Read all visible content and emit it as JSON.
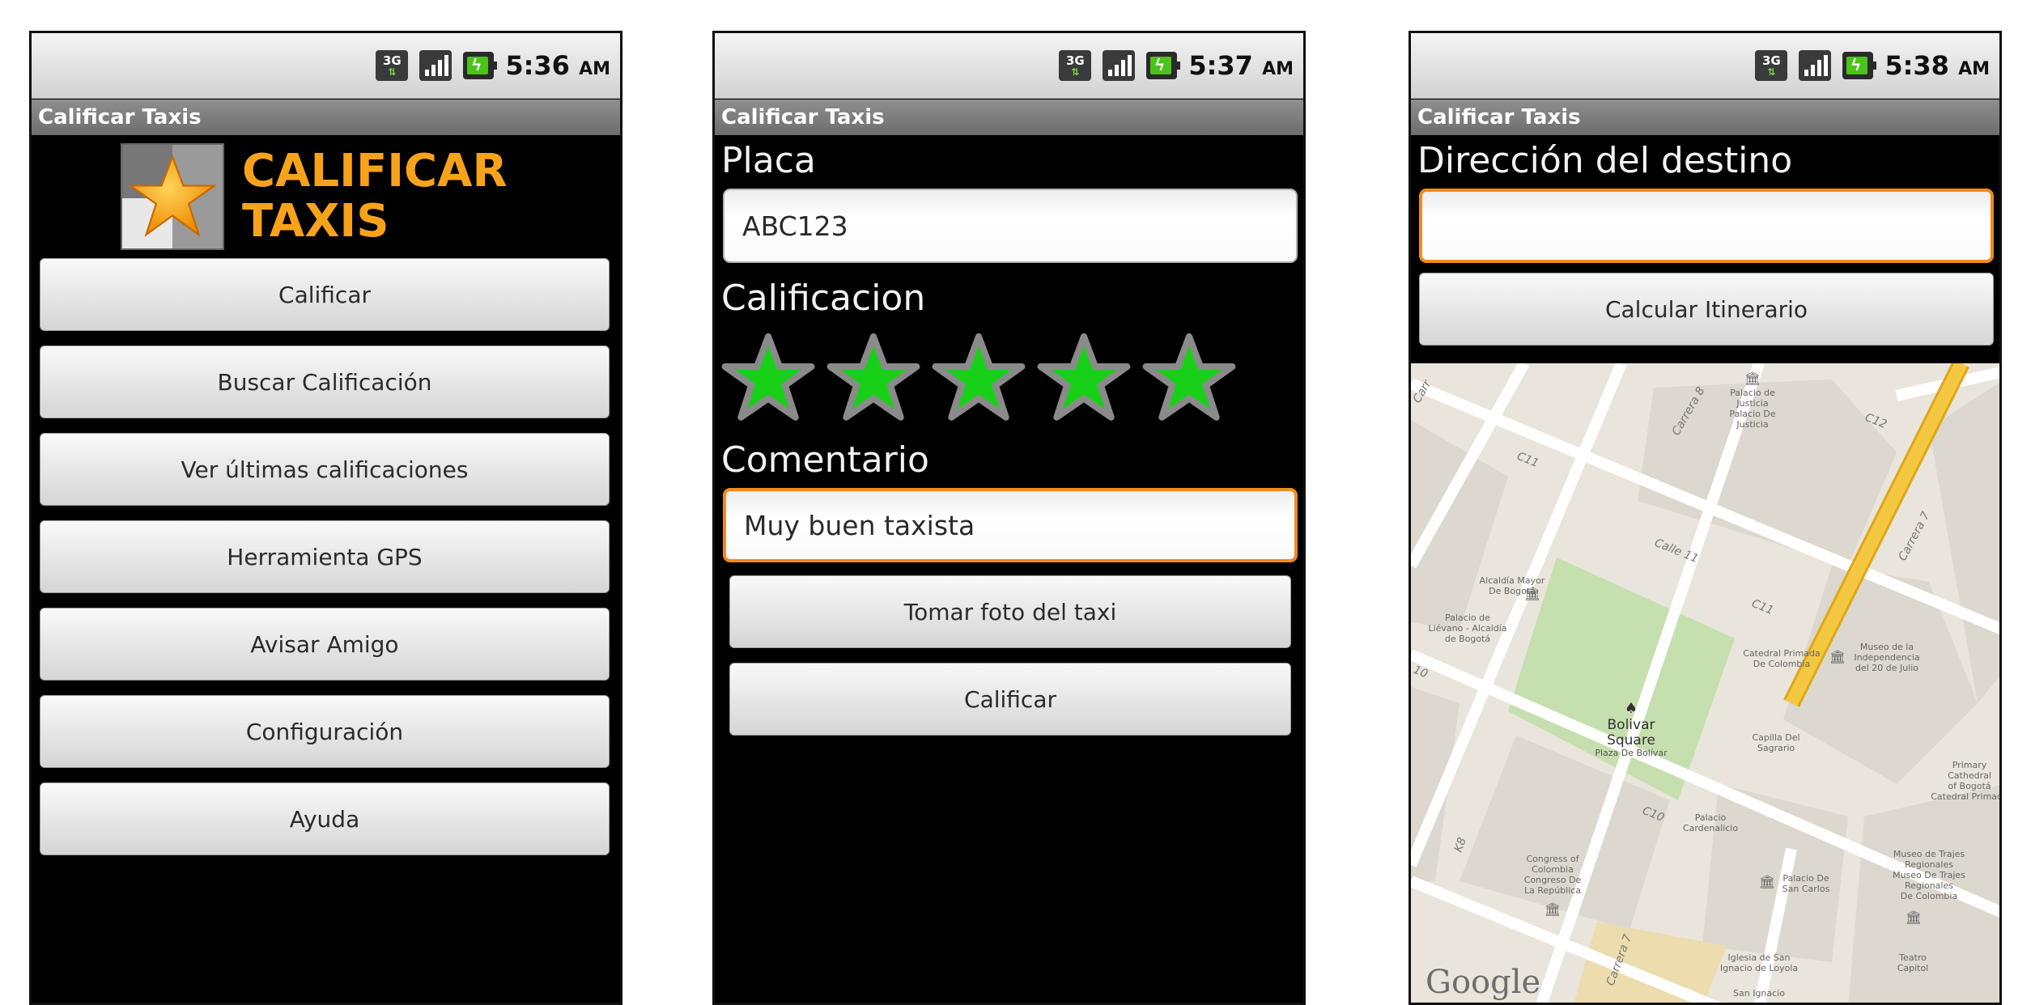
{
  "screens": [
    {
      "status": {
        "time": "5:36",
        "ampm": "AM",
        "network": "3G"
      },
      "title": "Calificar Taxis",
      "logo": {
        "line1": "CALIFICAR",
        "line2": "TAXIS"
      },
      "menu": [
        "Calificar",
        "Buscar Calificación",
        "Ver últimas calificaciones",
        "Herramienta GPS",
        "Avisar Amigo",
        "Configuración",
        "Ayuda"
      ]
    },
    {
      "status": {
        "time": "5:37",
        "ampm": "AM",
        "network": "3G"
      },
      "title": "Calificar Taxis",
      "placa_label": "Placa",
      "placa_value": "ABC123",
      "calificacion_label": "Calificacion",
      "rating": 5,
      "comentario_label": "Comentario",
      "comentario_value": "Muy buen taxista",
      "photo_button": "Tomar foto del taxi",
      "submit_button": "Calificar"
    },
    {
      "status": {
        "time": "5:38",
        "ampm": "AM",
        "network": "3G"
      },
      "title": "Calificar Taxis",
      "destino_label": "Dirección del destino",
      "destino_value": "",
      "calc_button": "Calcular Itinerario",
      "map": {
        "attribution": "Google",
        "labels": {
          "palacio_justicia": "Palacio de",
          "palacio_justicia2": "Justicia",
          "palacio_justicia3": "Palacio De",
          "palacio_justicia4": "Justicia",
          "carrera8": "Carrera 8",
          "c12": "C12",
          "c11": "C11",
          "carrera7": "Carrera 7",
          "calle11": "Calle 11",
          "c11b": "C11",
          "alcaldia": "Alcaldía Mayor",
          "alcaldia2": "De Bogotá",
          "lievano": "Palacio de",
          "lievano2": "Liévano - Alcaldía",
          "lievano3": "de Bogotá",
          "catedral": "Catedral Primada",
          "catedral2": "De Colombia",
          "museo_ind": "Museo de la",
          "museo_ind2": "Independencia",
          "museo_ind3": "del 20 de Julio",
          "c10": "10",
          "bolivar": "Bolivar",
          "bolivar2": "Square",
          "bolivar3": "Plaza De Bolívar",
          "capilla": "Capilla Del",
          "capilla2": "Sagrario",
          "primary": "Primary",
          "primary2": "Cathedral",
          "primary3": "of Bogotá",
          "primary4": "Catedral Primada",
          "c10b": "C10",
          "palacio_card": "Palacio",
          "palacio_card2": "Cardenalicio",
          "k8": "K8",
          "congress": "Congress of",
          "congress2": "Colombia",
          "congress3": "Congreso De",
          "congress4": "La República",
          "palacio_sc": "Palacio De",
          "palacio_sc2": "San Carlos",
          "museo_trajes": "Museo de Trajes",
          "museo_trajes2": "Regionales",
          "museo_trajes3": "Museo De Trajes",
          "museo_trajes4": "Regionales",
          "museo_trajes5": "De Colombia",
          "carrera7b": "Carrera 7",
          "iglesia": "Iglesia de San",
          "iglesia2": "Ignacio de Loyola",
          "teatro": "Teatro",
          "teatro2": "Capitol",
          "san_ignacio": "San Ignacio",
          "carr_top": "Carr"
        }
      }
    }
  ],
  "colors": {
    "focus": "#f08a1b",
    "star_fill": "#19d019",
    "logo_text": "#f7a21b"
  }
}
